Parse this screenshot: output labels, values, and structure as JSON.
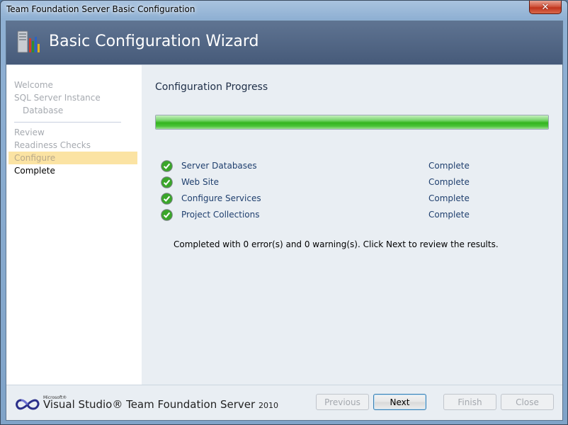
{
  "window": {
    "title": "Team Foundation Server Basic Configuration",
    "close_glyph": "✕"
  },
  "header": {
    "title": "Basic Configuration Wizard",
    "icon": "server-wizard-icon"
  },
  "nav": {
    "items": [
      {
        "label": "Welcome",
        "state": "visited"
      },
      {
        "label": "SQL Server Instance",
        "state": "visited"
      },
      {
        "label": "Database",
        "state": "visited"
      },
      {
        "label": "Review",
        "state": "visited"
      },
      {
        "label": "Readiness Checks",
        "state": "visited"
      },
      {
        "label": "Configure",
        "state": "selected"
      },
      {
        "label": "Complete",
        "state": "current"
      }
    ]
  },
  "main": {
    "title": "Configuration Progress",
    "progress_fraction": 1.0,
    "steps": [
      {
        "label": "Server Databases",
        "status": "Complete",
        "icon": "check-circle-icon"
      },
      {
        "label": "Web Site",
        "status": "Complete",
        "icon": "check-circle-icon"
      },
      {
        "label": "Configure Services",
        "status": "Complete",
        "icon": "check-circle-icon"
      },
      {
        "label": "Project Collections",
        "status": "Complete",
        "icon": "check-circle-icon"
      }
    ],
    "result_message": "Completed with 0 error(s) and 0 warning(s). Click Next to review the results."
  },
  "footer": {
    "brand_ms": "Microsoft®",
    "brand_name": "Visual Studio® Team Foundation Server",
    "brand_version": "2010",
    "buttons": {
      "previous": "Previous",
      "next": "Next",
      "finish": "Finish",
      "close": "Close"
    }
  },
  "colors": {
    "header": "#4f6483",
    "progress": "#3cb82a",
    "selected_nav": "#fbe3a3",
    "link_text": "#1f3f6e"
  }
}
